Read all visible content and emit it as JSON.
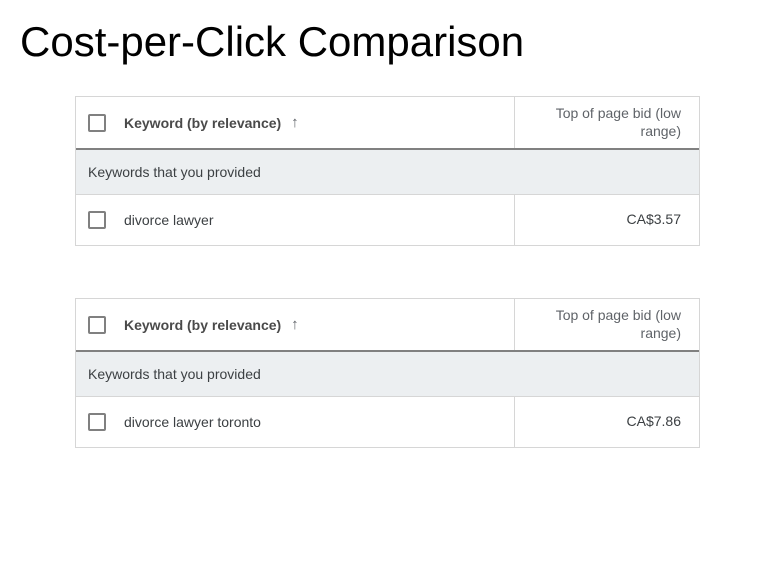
{
  "page": {
    "title": "Cost-per-Click Comparison"
  },
  "tables": [
    {
      "header": {
        "keyword_label": "Keyword (by relevance)",
        "sort_arrow": "↑",
        "bid_label": "Top of page bid (low range)"
      },
      "section_label": "Keywords that you provided",
      "rows": [
        {
          "keyword": "divorce lawyer",
          "bid": "CA$3.57"
        }
      ]
    },
    {
      "header": {
        "keyword_label": "Keyword (by relevance)",
        "sort_arrow": "↑",
        "bid_label": "Top of page bid (low range)"
      },
      "section_label": "Keywords that you provided",
      "rows": [
        {
          "keyword": "divorce lawyer toronto",
          "bid": "CA$7.86"
        }
      ]
    }
  ]
}
